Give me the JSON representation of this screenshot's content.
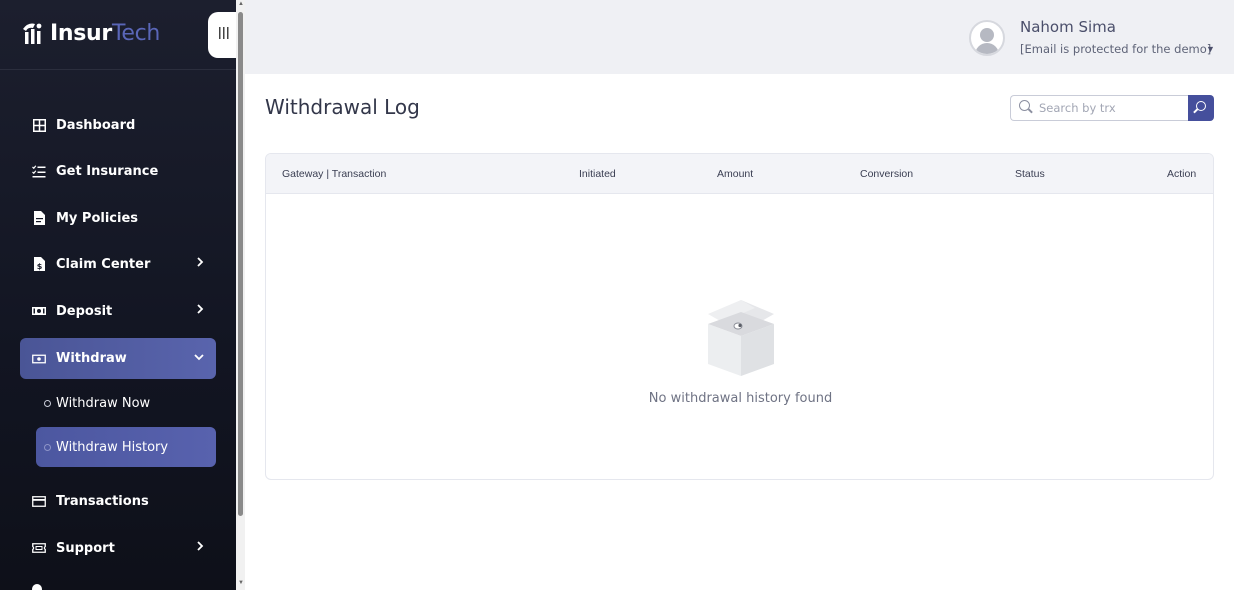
{
  "app": {
    "logo_part1": "Insur",
    "logo_part2": "Tech",
    "collapse_icon": "menu-lines-icon"
  },
  "sidebar": {
    "items": [
      {
        "label": "Dashboard",
        "icon": "grid-icon"
      },
      {
        "label": "Get Insurance",
        "icon": "list-check-icon"
      },
      {
        "label": "My Policies",
        "icon": "document-icon"
      },
      {
        "label": "Claim Center",
        "icon": "file-dollar-icon",
        "has_submenu": true
      },
      {
        "label": "Deposit",
        "icon": "money-icon",
        "has_submenu": true
      },
      {
        "label": "Withdraw",
        "icon": "cash-icon",
        "has_submenu": true,
        "expanded": true
      },
      {
        "label": "Transactions",
        "icon": "card-icon"
      },
      {
        "label": "Support",
        "icon": "ticket-icon",
        "has_submenu": true
      }
    ],
    "withdraw_sub": [
      {
        "label": "Withdraw Now",
        "active": false
      },
      {
        "label": "Withdraw History",
        "active": true
      }
    ]
  },
  "header": {
    "user_name": "Nahom Sima",
    "user_email": "[Email is protected for the demo]"
  },
  "main": {
    "title": "Withdrawal Log",
    "search_placeholder": "Search by trx",
    "table": {
      "columns": [
        "Gateway | Transaction",
        "Initiated",
        "Amount",
        "Conversion",
        "Status",
        "Action"
      ],
      "rows": []
    },
    "empty_message": "No withdrawal history found"
  },
  "colors": {
    "sidebar_bg": "#151826",
    "accent": "#4a5596",
    "header_bg": "#eff0f4"
  }
}
